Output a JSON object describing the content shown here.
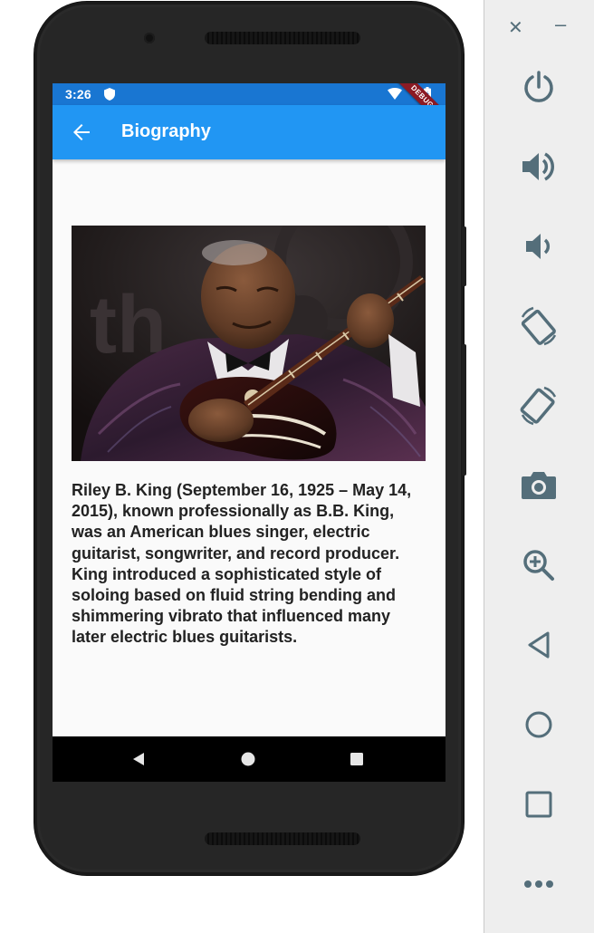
{
  "status_bar": {
    "time": "3:26",
    "debug_label": "DEBUG"
  },
  "app_bar": {
    "title": "Biography",
    "back_icon": "arrow-back-icon"
  },
  "content": {
    "image_alt": "B.B. King playing guitar on stage",
    "image_backdrop_text": "th",
    "bio": "Riley B. King (September 16, 1925 – May 14, 2015), known professionally as B.B. King, was an American blues singer, electric guitarist, songwriter, and record producer. King introduced a sophisticated style of soloing based on fluid string bending and shimmering vibrato that influenced many later electric blues guitarists."
  },
  "nav_bar": {
    "back": "triangle-back-icon",
    "home": "circle-home-icon",
    "recents": "square-recents-icon"
  },
  "emulator_panel": {
    "close": "✕",
    "minimize": "–",
    "buttons": [
      "power-icon",
      "volume-up-icon",
      "volume-down-icon",
      "rotate-left-icon",
      "rotate-right-icon",
      "camera-icon",
      "zoom-icon",
      "back-icon",
      "home-icon",
      "overview-icon",
      "more-icon"
    ]
  },
  "colors": {
    "app_bar": "#2196f3",
    "status_bar": "#1976d2",
    "panel_icon": "#546e7a",
    "debug_banner": "#8b1a24"
  }
}
